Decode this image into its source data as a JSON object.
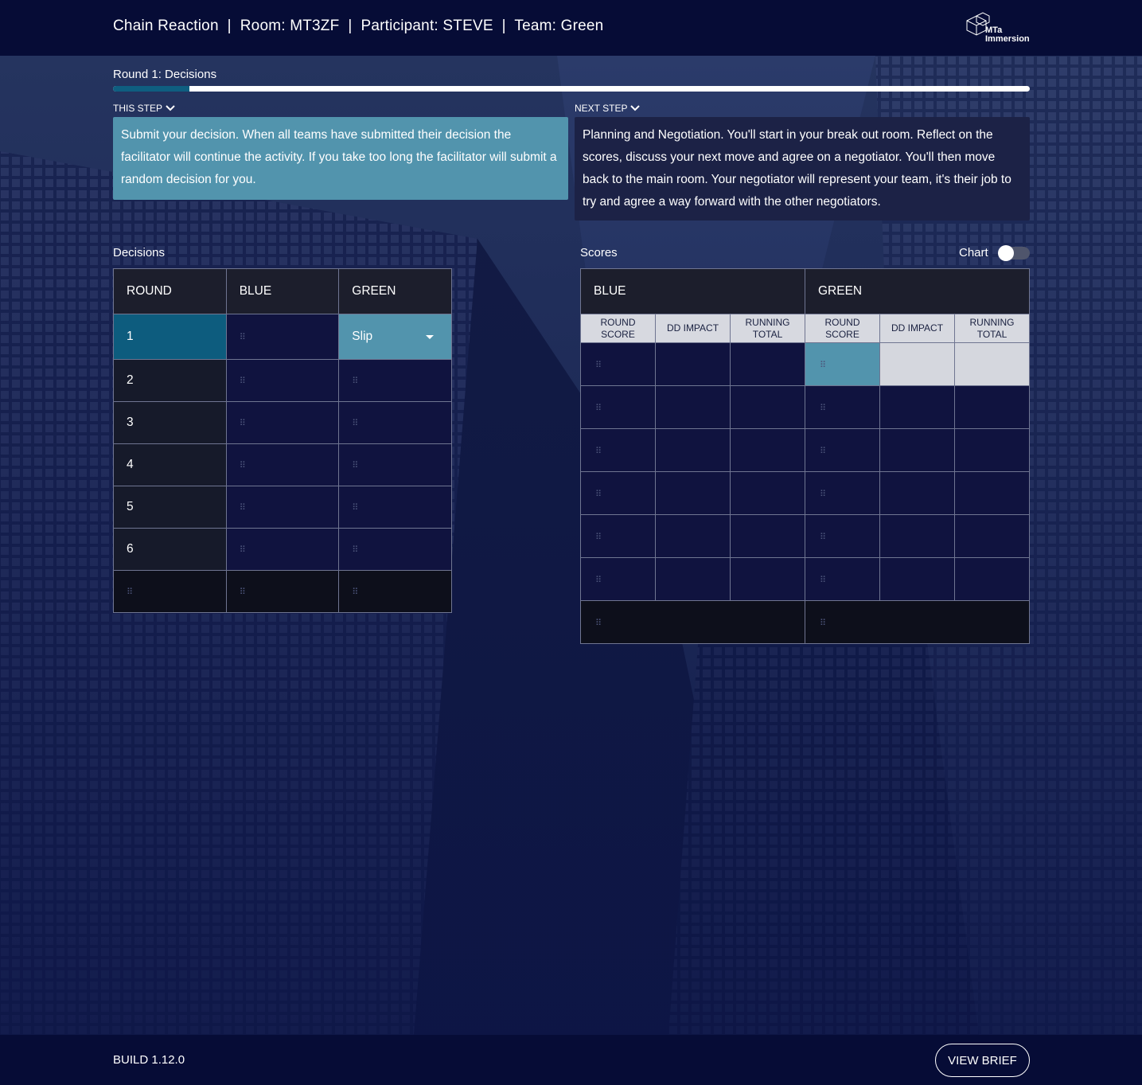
{
  "header": {
    "title": "Chain Reaction  |  Room: MT3ZF  |  Participant: STEVE  |  Team: Green",
    "logo_line1": "MTa",
    "logo_line2": "Immersion"
  },
  "round": {
    "title": "Round 1: Decisions",
    "progress_fraction": 0.083
  },
  "this_step": {
    "label": "THIS STEP",
    "text": "Submit your decision. When all teams have submitted their decision the facilitator will continue the activity. If you take too long the facilitator will submit a random decision for you."
  },
  "next_step": {
    "label": "NEXT STEP",
    "text": "Planning and Negotiation. You'll start in your break out room. Reflect on the scores, discuss your next move and agree on a negotiator. You'll then move back to the main room. Your negotiator will represent your team, it's their job to try and agree a way forward with the other negotiators."
  },
  "decisions": {
    "title": "Decisions",
    "columns": [
      "ROUND",
      "BLUE",
      "GREEN"
    ],
    "rounds": [
      "1",
      "2",
      "3",
      "4",
      "5",
      "6"
    ],
    "green_selected": "Slip",
    "handle": "⠿"
  },
  "scores": {
    "title": "Scores",
    "chart_label": "Chart",
    "chart_toggle_on": false,
    "teams": [
      "BLUE",
      "GREEN"
    ],
    "subcolumns": [
      "ROUND SCORE",
      "DD IMPACT",
      "RUNNING TOTAL",
      "ROUND SCORE",
      "DD IMPACT",
      "RUNNING TOTAL"
    ]
  },
  "footer": {
    "build": "BUILD 1.12.0",
    "view_brief": "VIEW BRIEF"
  },
  "colors": {
    "topbar": "#060c36",
    "accent_teal": "#5294ad",
    "current_round": "#0d5c7e"
  }
}
